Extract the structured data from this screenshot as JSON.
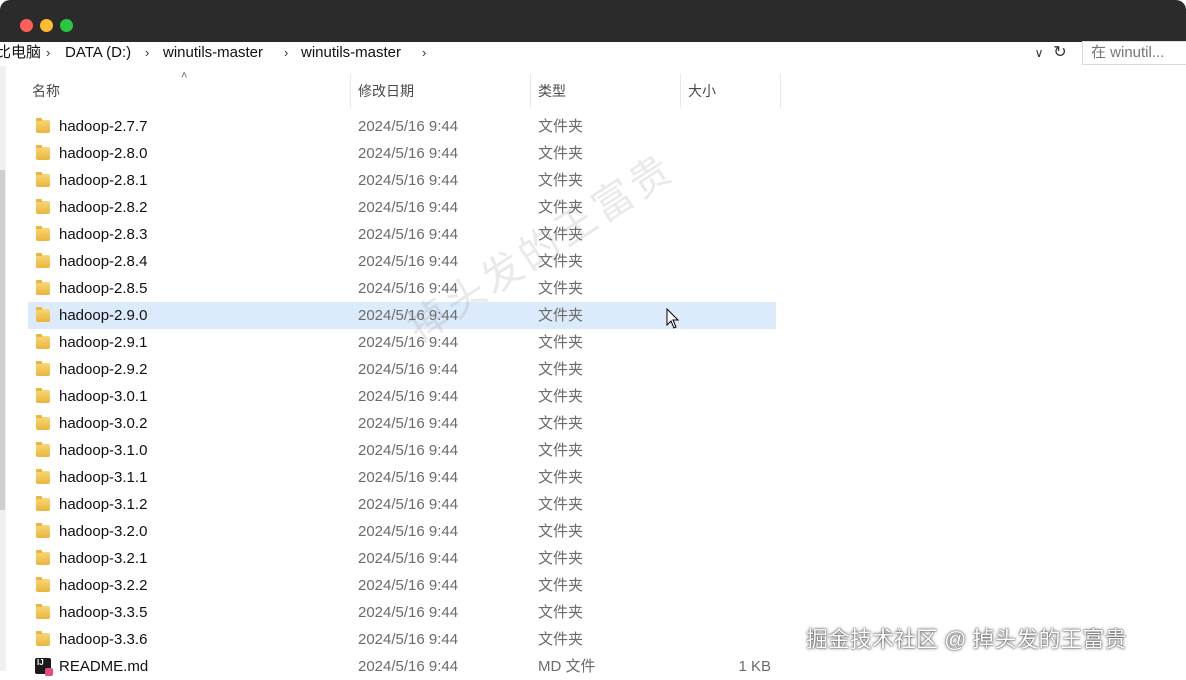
{
  "window": {
    "traffic_lights": [
      "close",
      "minimize",
      "zoom"
    ]
  },
  "breadcrumb": [
    "比电脑",
    "DATA (D:)",
    "winutils-master",
    "winutils-master"
  ],
  "search": {
    "placeholder": "在 winutil..."
  },
  "columns": {
    "name": "名称",
    "date": "修改日期",
    "type": "类型",
    "size": "大小"
  },
  "files": [
    {
      "name": "hadoop-2.7.7",
      "date": "2024/5/16 9:44",
      "type": "文件夹",
      "size": "",
      "icon": "folder-icon"
    },
    {
      "name": "hadoop-2.8.0",
      "date": "2024/5/16 9:44",
      "type": "文件夹",
      "size": "",
      "icon": "folder-icon"
    },
    {
      "name": "hadoop-2.8.1",
      "date": "2024/5/16 9:44",
      "type": "文件夹",
      "size": "",
      "icon": "folder-icon"
    },
    {
      "name": "hadoop-2.8.2",
      "date": "2024/5/16 9:44",
      "type": "文件夹",
      "size": "",
      "icon": "folder-icon"
    },
    {
      "name": "hadoop-2.8.3",
      "date": "2024/5/16 9:44",
      "type": "文件夹",
      "size": "",
      "icon": "folder-icon"
    },
    {
      "name": "hadoop-2.8.4",
      "date": "2024/5/16 9:44",
      "type": "文件夹",
      "size": "",
      "icon": "folder-icon"
    },
    {
      "name": "hadoop-2.8.5",
      "date": "2024/5/16 9:44",
      "type": "文件夹",
      "size": "",
      "icon": "folder-icon"
    },
    {
      "name": "hadoop-2.9.0",
      "date": "2024/5/16 9:44",
      "type": "文件夹",
      "size": "",
      "icon": "folder-icon",
      "selected": true
    },
    {
      "name": "hadoop-2.9.1",
      "date": "2024/5/16 9:44",
      "type": "文件夹",
      "size": "",
      "icon": "folder-icon"
    },
    {
      "name": "hadoop-2.9.2",
      "date": "2024/5/16 9:44",
      "type": "文件夹",
      "size": "",
      "icon": "folder-icon"
    },
    {
      "name": "hadoop-3.0.1",
      "date": "2024/5/16 9:44",
      "type": "文件夹",
      "size": "",
      "icon": "folder-icon"
    },
    {
      "name": "hadoop-3.0.2",
      "date": "2024/5/16 9:44",
      "type": "文件夹",
      "size": "",
      "icon": "folder-icon"
    },
    {
      "name": "hadoop-3.1.0",
      "date": "2024/5/16 9:44",
      "type": "文件夹",
      "size": "",
      "icon": "folder-icon"
    },
    {
      "name": "hadoop-3.1.1",
      "date": "2024/5/16 9:44",
      "type": "文件夹",
      "size": "",
      "icon": "folder-icon"
    },
    {
      "name": "hadoop-3.1.2",
      "date": "2024/5/16 9:44",
      "type": "文件夹",
      "size": "",
      "icon": "folder-icon"
    },
    {
      "name": "hadoop-3.2.0",
      "date": "2024/5/16 9:44",
      "type": "文件夹",
      "size": "",
      "icon": "folder-icon"
    },
    {
      "name": "hadoop-3.2.1",
      "date": "2024/5/16 9:44",
      "type": "文件夹",
      "size": "",
      "icon": "folder-icon"
    },
    {
      "name": "hadoop-3.2.2",
      "date": "2024/5/16 9:44",
      "type": "文件夹",
      "size": "",
      "icon": "folder-icon"
    },
    {
      "name": "hadoop-3.3.5",
      "date": "2024/5/16 9:44",
      "type": "文件夹",
      "size": "",
      "icon": "folder-icon"
    },
    {
      "name": "hadoop-3.3.6",
      "date": "2024/5/16 9:44",
      "type": "文件夹",
      "size": "",
      "icon": "folder-icon"
    },
    {
      "name": "README.md",
      "date": "2024/5/16 9:44",
      "type": "MD 文件",
      "size": "1 KB",
      "icon": "markdown-file-icon"
    }
  ],
  "watermark": "掉头发的王富贵",
  "footer_watermark": "掘金技术社区 @ 掉头发的王富贵",
  "colors": {
    "selection": "#dcebfb",
    "folder": "#f2c94c",
    "titlebar": "#2b2b2b"
  }
}
